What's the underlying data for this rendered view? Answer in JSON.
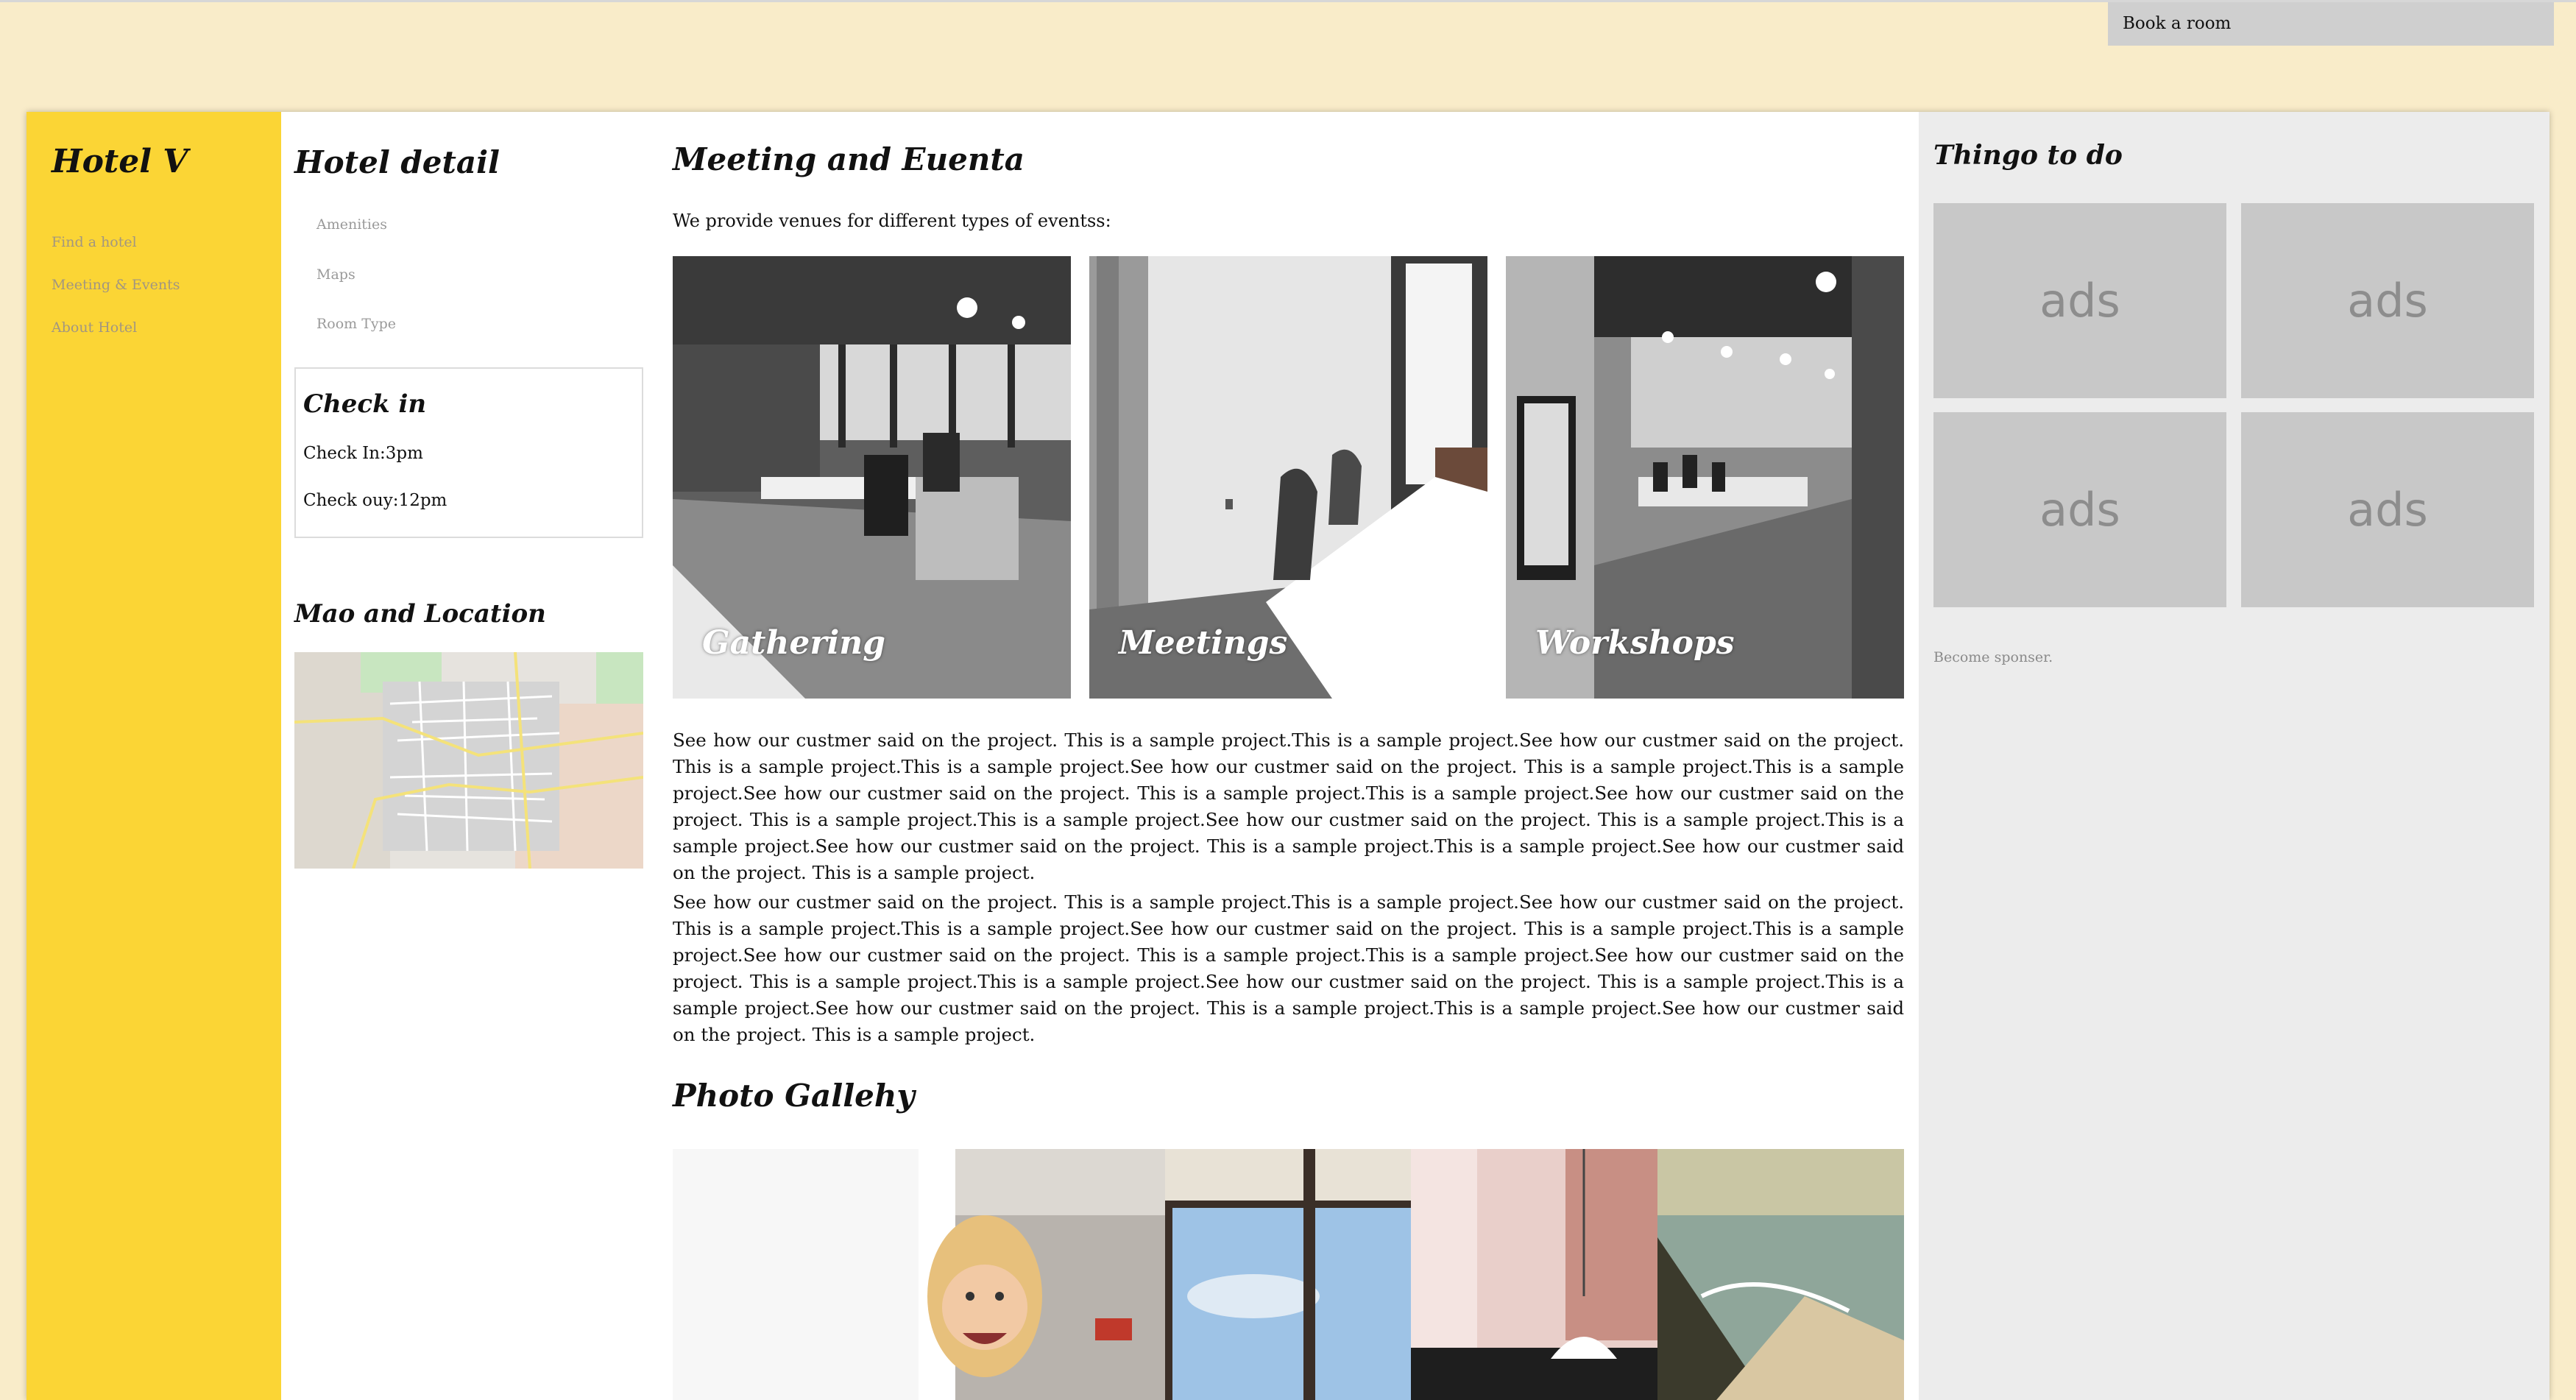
{
  "header": {
    "book_button": "Book a room"
  },
  "sidebar": {
    "brand": "Hotel V",
    "items": [
      {
        "label": "Find a hotel"
      },
      {
        "label": "Meeting & Events"
      },
      {
        "label": "About Hotel"
      }
    ]
  },
  "detail": {
    "title": "Hotel detail",
    "links": [
      {
        "label": "Amenities"
      },
      {
        "label": "Maps"
      },
      {
        "label": "Room Type"
      }
    ],
    "checkin": {
      "title": "Check in",
      "check_in": "Check In:3pm",
      "check_out": "Check ouy:12pm"
    },
    "map_title": "Mao and Location"
  },
  "main": {
    "title": "Meeting and Euenta",
    "intro": "We provide venues for different types of eventss:",
    "venues": [
      {
        "label": "Gathering"
      },
      {
        "label": "Meetings"
      },
      {
        "label": "Workshops"
      }
    ],
    "paragraph_1": "See how our custmer said on the project. This is a sample project.This is a sample project.See how our custmer said on the project. This is a sample project.This is a sample project.See how our custmer said on the project. This is a sample project.This is a sample project.See how our custmer said on the project. This is a sample project.This is a sample project.See how our custmer said on the project. This is a sample project.This is a sample project.See how our custmer said on the project. This is a sample project.This is a sample project.See how our custmer said on the project. This is a sample project.This is a sample project.See how our custmer said on the project. This is a sample project.",
    "paragraph_2": "See how our custmer said on the project. This is a sample project.This is a sample project.See how our custmer said on the project. This is a sample project.This is a sample project.See how our custmer said on the project. This is a sample project.This is a sample project.See how our custmer said on the project. This is a sample project.This is a sample project.See how our custmer said on the project. This is a sample project.This is a sample project.See how our custmer said on the project. This is a sample project.This is a sample project.See how our custmer said on the project. This is a sample project.This is a sample project.See how our custmer said on the project. This is a sample project.",
    "gallery_title": "Photo Gallehy"
  },
  "things": {
    "title": "Thingo to do",
    "ads": [
      {
        "label": "ads"
      },
      {
        "label": "ads"
      },
      {
        "label": "ads"
      },
      {
        "label": "ads"
      }
    ],
    "sponsor_link": "Become sponser."
  }
}
